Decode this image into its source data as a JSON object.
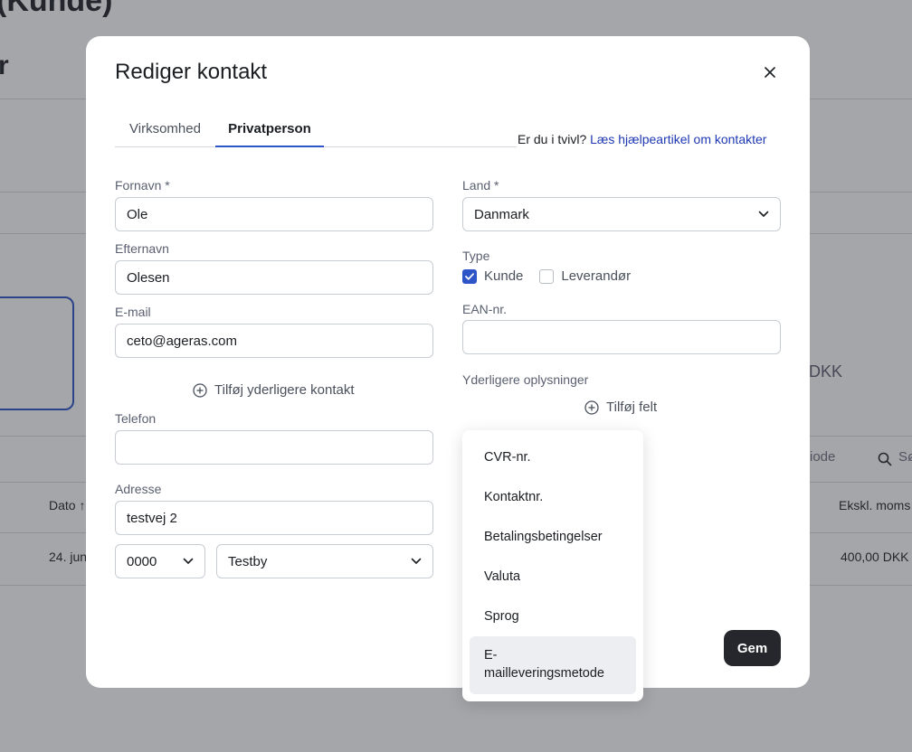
{
  "background": {
    "title": "(Kunde)",
    "subtitle": "r",
    "amount_suffix": "DKK",
    "filter_label": "riode",
    "search_label": "Sø",
    "table": {
      "col_date": "Dato ↑",
      "col_excl_vat": "Ekskl. moms",
      "row_date": "24. jun",
      "row_amount": "400,00 DKK"
    }
  },
  "modal": {
    "title": "Rediger kontakt",
    "close_label": "×",
    "tabs": [
      {
        "label": "Virksomhed"
      },
      {
        "label": "Privatperson"
      }
    ],
    "help": {
      "text": "Er du i tvivl?",
      "link": "Læs hjælpeartikel om kontakter"
    },
    "fields": {
      "first_name": {
        "label": "Fornavn *",
        "value": "Ole"
      },
      "last_name": {
        "label": "Efternavn",
        "value": "Olesen"
      },
      "email": {
        "label": "E-mail",
        "value": "ceto@ageras.com"
      },
      "add_contact": "Tilføj yderligere kontakt",
      "phone": {
        "label": "Telefon",
        "value": ""
      },
      "address": {
        "label": "Adresse",
        "value": "testvej 2"
      },
      "zip": {
        "value": "0000"
      },
      "city": {
        "value": "Testby"
      },
      "country": {
        "label": "Land *",
        "value": "Danmark"
      },
      "type": {
        "label": "Type",
        "customer": {
          "label": "Kunde",
          "checked": true
        },
        "supplier": {
          "label": "Leverandør",
          "checked": false
        }
      },
      "ean": {
        "label": "EAN-nr.",
        "value": ""
      },
      "extra_info": {
        "label": "Yderligere oplysninger"
      },
      "add_field": "Tilføj felt"
    },
    "save_label": "Gem"
  },
  "dropdown": {
    "items": [
      {
        "label": "CVR-nr."
      },
      {
        "label": "Kontaktnr."
      },
      {
        "label": "Betalingsbetingelser"
      },
      {
        "label": "Valuta"
      },
      {
        "label": "Sprog"
      },
      {
        "label": "E-mailleveringsmetode",
        "label_line1": "E-",
        "label_line2": "mailleveringsmetode",
        "highlighted": true
      }
    ]
  },
  "colors": {
    "accent": "#2d55c8",
    "link": "#1e38b3",
    "primary_button": "#25272d",
    "overlay": "rgba(40,42,50,0.42)"
  }
}
